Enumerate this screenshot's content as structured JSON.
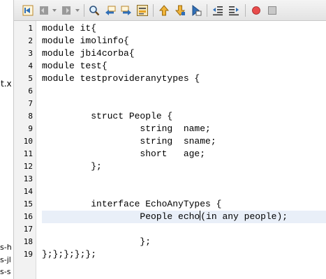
{
  "background_window": {
    "fragments": [
      "t.x",
      "s-h",
      "s-jl",
      "s-s"
    ]
  },
  "toolbar": {
    "buttons": [
      {
        "name": "last-edit-icon"
      },
      {
        "name": "back-icon"
      },
      {
        "name": "forward-icon"
      },
      {
        "name": "find-icon"
      },
      {
        "name": "find-previous-icon"
      },
      {
        "name": "find-next-icon"
      },
      {
        "name": "toggle-highlight-icon"
      },
      {
        "name": "previous-bookmark-icon"
      },
      {
        "name": "next-bookmark-icon"
      },
      {
        "name": "toggle-bookmark-icon"
      },
      {
        "name": "shift-left-icon"
      },
      {
        "name": "shift-right-icon"
      },
      {
        "name": "start-macro-icon"
      },
      {
        "name": "stop-macro-icon"
      }
    ],
    "colors": {
      "macro_record": "#e84c4c",
      "arrow_up": "#e8a526",
      "arrow_blue": "#2f6fb8"
    }
  },
  "editor": {
    "current_line": 16,
    "lines": [
      {
        "num": "1",
        "text": "module it{"
      },
      {
        "num": "2",
        "text": "module imolinfo{"
      },
      {
        "num": "3",
        "text": "module jbi4corba{"
      },
      {
        "num": "4",
        "text": "module test{"
      },
      {
        "num": "5",
        "text": "module testprovideranytypes {"
      },
      {
        "num": "6",
        "text": ""
      },
      {
        "num": "7",
        "text": ""
      },
      {
        "num": "8",
        "text": "         struct People {"
      },
      {
        "num": "9",
        "text": "                  string  name;"
      },
      {
        "num": "10",
        "text": "                  string  sname;"
      },
      {
        "num": "11",
        "text": "                  short   age;"
      },
      {
        "num": "12",
        "text": "         };"
      },
      {
        "num": "13",
        "text": ""
      },
      {
        "num": "14",
        "text": ""
      },
      {
        "num": "15",
        "text": "         interface EchoAnyTypes {"
      },
      {
        "num": "16",
        "text_before_caret": "                  People echo",
        "text_after_caret": "(in any people);"
      },
      {
        "num": "17",
        "text": ""
      },
      {
        "num": "18",
        "text": "                  };"
      },
      {
        "num": "19",
        "text": "};};};};};"
      }
    ]
  }
}
